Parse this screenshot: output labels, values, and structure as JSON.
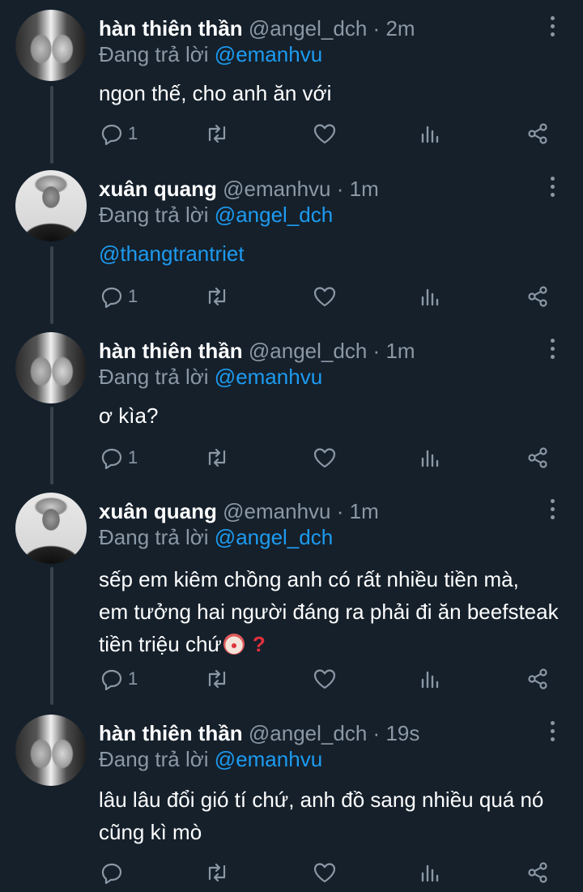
{
  "replying_prefix": "Đang trả lời",
  "tweets": [
    {
      "name": "hàn thiên thần",
      "handle": "@angel_dch",
      "time": "2m",
      "avatar": "angel",
      "reply_to": "@emanhvu",
      "text": [
        "ngon thế, cho anh ăn với"
      ],
      "reply_count": "1"
    },
    {
      "name": "xuân quang",
      "handle": "@emanhvu",
      "time": "1m",
      "avatar": "xuan",
      "reply_to": "@angel_dch",
      "text": [
        "@thangtrantriet"
      ],
      "reply_count": "1"
    },
    {
      "name": "hàn thiên thần",
      "handle": "@angel_dch",
      "time": "1m",
      "avatar": "angel",
      "reply_to": "@emanhvu",
      "text": [
        "ơ kìa?"
      ],
      "reply_count": "1"
    },
    {
      "name": "xuân quang",
      "handle": "@emanhvu",
      "time": "1m",
      "avatar": "xuan",
      "reply_to": "@angel_dch",
      "text": [
        "sếp em kiêm chồng anh có rất nhiều tiền mà,",
        "em tưởng hai người đáng ra phải đi ăn beefsteak",
        "tiền triệu chứ"
      ],
      "emoji": [
        "clown-face",
        "red-question-mark"
      ],
      "reply_count": "1"
    },
    {
      "name": "hàn thiên thần",
      "handle": "@angel_dch",
      "time": "19s",
      "avatar": "angel",
      "reply_to": "@emanhvu",
      "text": [
        "lâu lâu đổi gió tí chứ, anh đồ sang nhiều quá nó",
        "cũng kì mò"
      ],
      "reply_count": ""
    }
  ],
  "icons": [
    "reply-icon",
    "retweet-icon",
    "like-icon",
    "views-icon",
    "share-icon",
    "more-icon"
  ],
  "colors": {
    "background": "#15202b",
    "text": "#ffffff",
    "secondary": "#8b98a5",
    "accent": "#1d9bf0",
    "thread_line": "#38444d"
  }
}
